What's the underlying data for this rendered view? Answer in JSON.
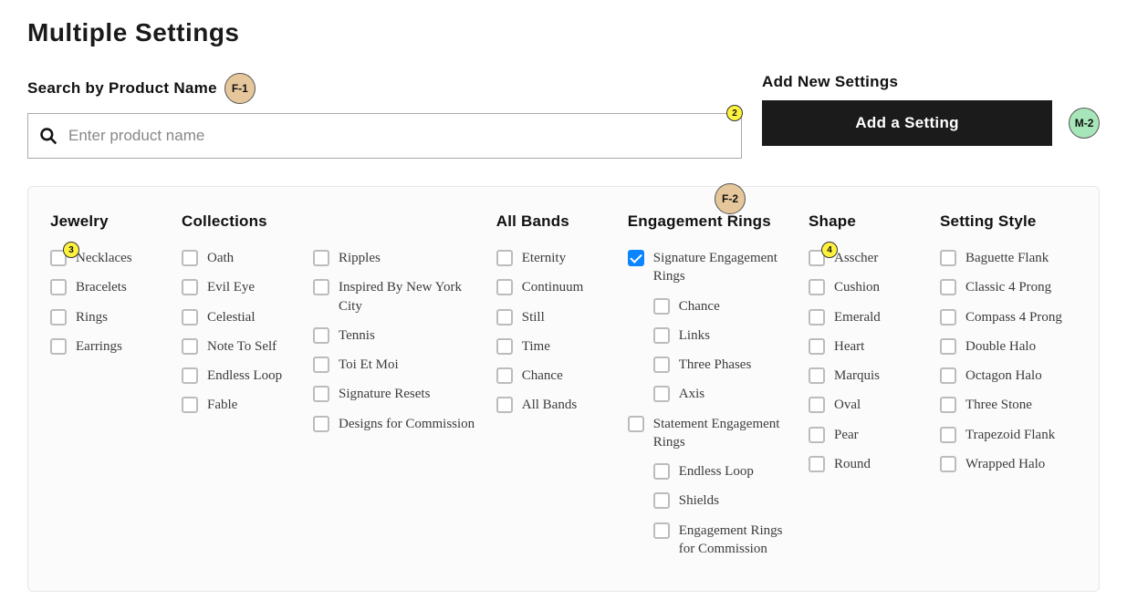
{
  "page_title": "Multiple Settings",
  "search": {
    "label": "Search by Product Name",
    "placeholder": "Enter product name"
  },
  "add_new": {
    "label": "Add New Settings",
    "button": "Add a Setting"
  },
  "badges": {
    "f1": "F-1",
    "y2": "2",
    "y3": "3",
    "f2": "F-2",
    "y4": "4",
    "m2": "M-2"
  },
  "filters": {
    "jewelry": {
      "title": "Jewelry",
      "items": [
        "Necklaces",
        "Bracelets",
        "Rings",
        "Earrings"
      ]
    },
    "collections": {
      "title": "Collections",
      "col1": [
        "Oath",
        "Evil Eye",
        "Celestial",
        "Note To Self",
        "Endless Loop",
        "Fable"
      ],
      "col2": [
        "Ripples",
        "Inspired By New York City",
        "Tennis",
        "Toi Et Moi",
        "Signature Resets",
        "Designs for Commission"
      ]
    },
    "bands": {
      "title": "All Bands",
      "items": [
        "Eternity",
        "Continuum",
        "Still",
        "Time",
        "Chance",
        "All Bands"
      ]
    },
    "engagement": {
      "title": "Engagement Rings",
      "signature": {
        "label": "Signature Engagement Rings",
        "checked": true,
        "sub": [
          "Chance",
          "Links",
          "Three Phases",
          "Axis"
        ]
      },
      "statement": {
        "label": "Statement Engagement Rings",
        "checked": false,
        "sub": [
          "Endless Loop",
          "Shields",
          "Engagement Rings for Commission"
        ]
      }
    },
    "shape": {
      "title": "Shape",
      "items": [
        "Asscher",
        "Cushion",
        "Emerald",
        "Heart",
        "Marquis",
        "Oval",
        "Pear",
        "Round"
      ]
    },
    "style": {
      "title": "Setting Style",
      "items": [
        "Baguette Flank",
        "Classic 4 Prong",
        "Compass 4 Prong",
        "Double Halo",
        "Octagon Halo",
        "Three Stone",
        "Trapezoid Flank",
        "Wrapped Halo"
      ]
    }
  }
}
